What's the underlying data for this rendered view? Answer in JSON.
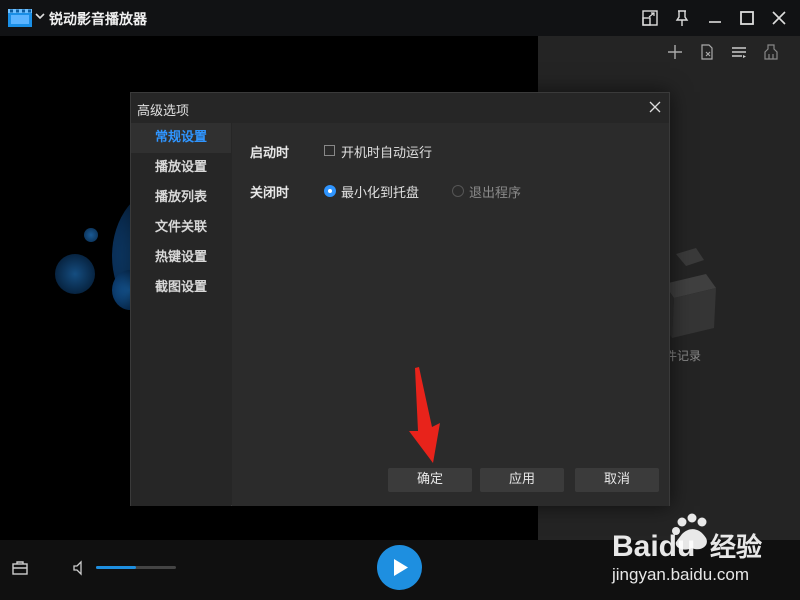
{
  "app": {
    "title": "锐动影音播放器"
  },
  "playlist": {
    "empty_text": "件记录"
  },
  "player": {
    "volume_fraction": 0.5
  },
  "dialog": {
    "title": "高级选项",
    "sidebar": [
      {
        "label": "常规设置",
        "active": true
      },
      {
        "label": "播放设置",
        "active": false
      },
      {
        "label": "播放列表",
        "active": false
      },
      {
        "label": "文件关联",
        "active": false
      },
      {
        "label": "热键设置",
        "active": false
      },
      {
        "label": "截图设置",
        "active": false
      }
    ],
    "startup": {
      "label": "启动时",
      "checkbox_label": "开机时自动运行",
      "checked": false
    },
    "close": {
      "label": "关闭时",
      "option_minimize": "最小化到托盘",
      "option_exit": "退出程序",
      "selected": "minimize"
    },
    "buttons": {
      "ok": "确定",
      "apply": "应用",
      "cancel": "取消"
    }
  },
  "watermark": {
    "brand": "Baidu",
    "brand_cn": "经验",
    "url": "jingyan.baidu.com"
  },
  "colors": {
    "accent": "#2f95ff",
    "play": "#1e8fe0",
    "arrow": "#e8231b"
  }
}
